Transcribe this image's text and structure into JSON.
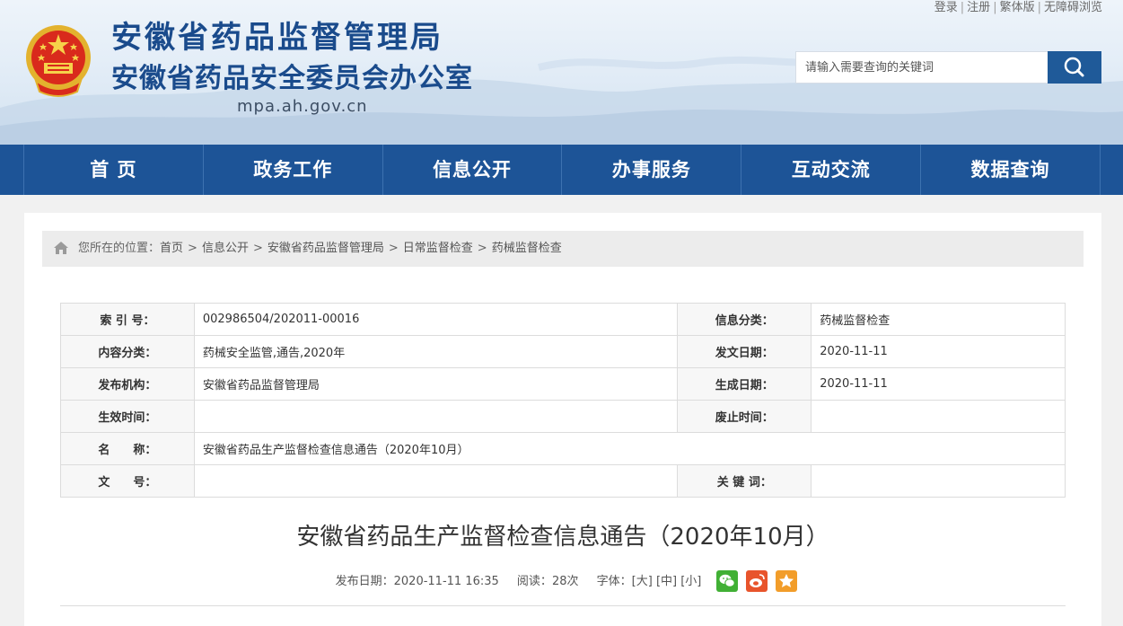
{
  "header": {
    "title": "安徽省药品监督管理局",
    "subtitle": "安徽省药品安全委员会办公室",
    "domain": "mpa.ah.gov.cn",
    "top_links": [
      "登录",
      "注册",
      "繁体版",
      "无障碍浏览"
    ],
    "top_links_separator": "|",
    "search_placeholder": "请输入需要查询的关键词"
  },
  "nav": {
    "items": [
      "首 页",
      "政务工作",
      "信息公开",
      "办事服务",
      "互动交流",
      "数据查询"
    ]
  },
  "breadcrumb": {
    "prefix": "您所在的位置：",
    "items": [
      "首页",
      "信息公开",
      "安徽省药品监督管理局",
      "日常监督检查",
      "药械监督检查"
    ],
    "separator": ">"
  },
  "info_table": {
    "index_label": "索 引 号：",
    "index_value": "002986504/202011-00016",
    "category_label": "信息分类：",
    "category_value": "药械监督检查",
    "content_label": "内容分类：",
    "content_value": "药械安全监管,通告,2020年",
    "issue_date_label": "发文日期：",
    "issue_date_value": "2020-11-11",
    "org_label": "发布机构：",
    "org_value": "安徽省药品监督管理局",
    "gen_date_label": "生成日期：",
    "gen_date_value": "2020-11-11",
    "effective_label": "生效时间：",
    "effective_value": "",
    "abolish_label": "废止时间：",
    "abolish_value": "",
    "name_label": "名　　称：",
    "name_value": "安徽省药品生产监督检查信息通告（2020年10月）",
    "docno_label": "文　　号：",
    "docno_value": "",
    "keywords_label": "关 键 词：",
    "keywords_value": ""
  },
  "article": {
    "title": "安徽省药品生产监督检查信息通告（2020年10月）",
    "publish_label": "发布日期：",
    "publish_value": "2020-11-11 16:35",
    "reads_label": "阅读：",
    "reads_value": "28次",
    "font_label": "字体：",
    "font_large": "[大]",
    "font_medium": "[中]",
    "font_small": "[小]"
  },
  "share_icons": [
    "wechat-icon",
    "weibo-icon",
    "star-icon"
  ],
  "colors": {
    "nav_bg": "#1d5497",
    "title_blue": "#1a4b8c",
    "wechat": "#41b035",
    "weibo": "#e8542c",
    "favorite": "#f29d2a"
  }
}
